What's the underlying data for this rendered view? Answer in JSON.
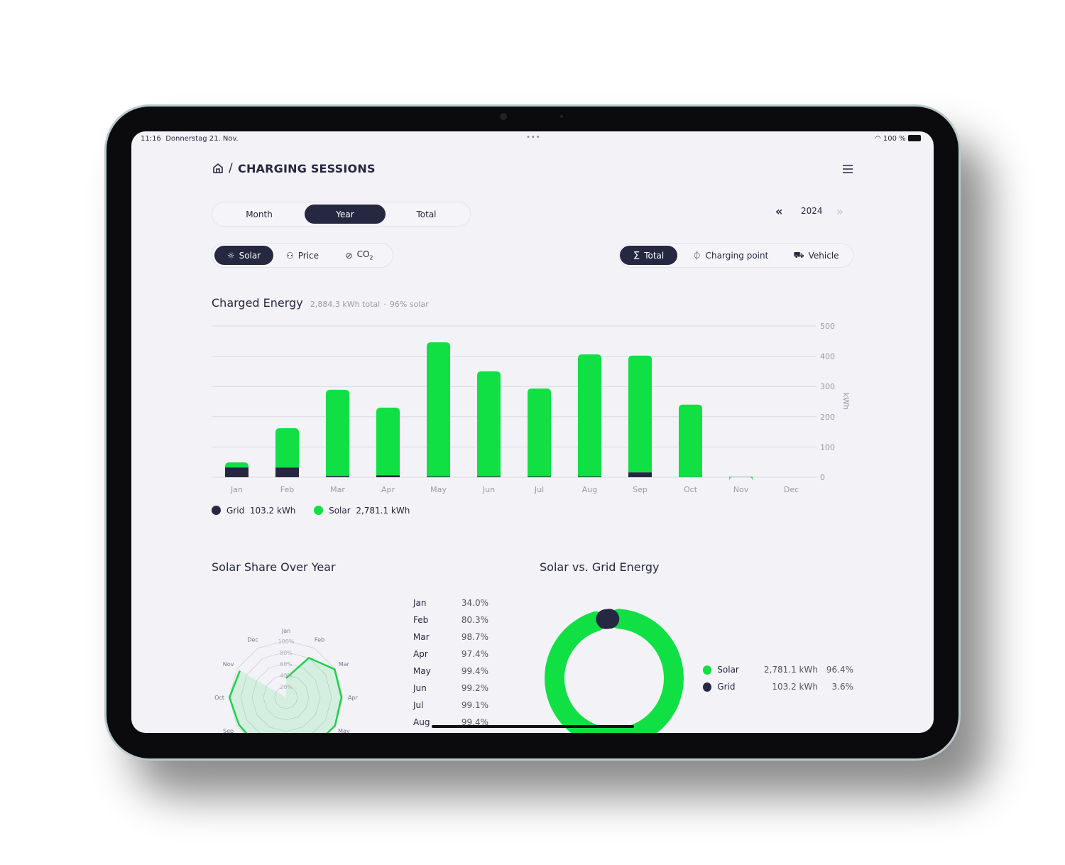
{
  "colors": {
    "solar": "#10e044",
    "grid": "#262740",
    "accent_dark": "#262740"
  },
  "status_bar": {
    "time": "11:16",
    "date": "Donnerstag 21. Nov.",
    "battery": "100 %"
  },
  "header": {
    "icon": "home-icon",
    "separator": "/",
    "title": "CHARGING SESSIONS",
    "menu_icon": "hamburger-icon"
  },
  "period_tabs": [
    {
      "label": "Month"
    },
    {
      "label": "Year",
      "selected": true
    },
    {
      "label": "Total"
    }
  ],
  "year_nav": {
    "prev": "«",
    "year": "2024",
    "next": "»"
  },
  "metric_filters": [
    {
      "label": "Solar",
      "icon": "sun-icon",
      "selected": true
    },
    {
      "label": "Price",
      "icon": "coins-icon"
    },
    {
      "label": "CO",
      "sub": "2",
      "icon": "leaf-icon"
    }
  ],
  "group_filters": [
    {
      "label": "Total",
      "icon": "sigma-icon",
      "selected": true
    },
    {
      "label": "Charging point",
      "icon": "plug-icon"
    },
    {
      "label": "Vehicle",
      "icon": "car-icon"
    }
  ],
  "charged_energy": {
    "title": "Charged Energy",
    "summary": "2,884.3 kWh total",
    "solar_share": "96% solar",
    "sep": "·"
  },
  "chart_data": [
    {
      "type": "bar",
      "stacked": true,
      "categories": [
        "Jan",
        "Feb",
        "Mar",
        "Apr",
        "May",
        "Jun",
        "Jul",
        "Aug",
        "Sep",
        "Oct",
        "Nov",
        "Dec"
      ],
      "series": [
        {
          "name": "Grid",
          "values": [
            32.3,
            32,
            3.8,
            6,
            2.7,
            2.8,
            2.6,
            2.4,
            16,
            0.5,
            0.5,
            0
          ]
        },
        {
          "name": "Solar",
          "values": [
            16.7,
            130,
            285.2,
            224,
            443.3,
            347.2,
            290.4,
            403.6,
            386,
            239.5,
            0.3,
            0
          ]
        }
      ],
      "ylabel": "kWh",
      "ylim": [
        0,
        500
      ],
      "yticks": [
        0,
        100,
        200,
        300,
        400,
        500
      ],
      "grid": true,
      "legend": [
        {
          "name": "Grid",
          "value": "103.2 kWh"
        },
        {
          "name": "Solar",
          "value": "2,781.1 kWh"
        }
      ]
    },
    {
      "type": "radar",
      "title": "Solar Share Over Year",
      "categories": [
        "Jan",
        "Feb",
        "Mar",
        "Apr",
        "May",
        "Jun",
        "Jul",
        "Aug",
        "Sep",
        "Oct",
        "Nov",
        "Dec"
      ],
      "values": [
        34.0,
        80.3,
        98.7,
        97.4,
        99.4,
        99.2,
        99.1,
        99.4,
        96,
        99.8,
        94,
        0
      ],
      "rings": [
        "20%",
        "40%",
        "60%",
        "80%",
        "100%"
      ],
      "table": [
        [
          "Jan",
          "34.0%"
        ],
        [
          "Feb",
          "80.3%"
        ],
        [
          "Mar",
          "98.7%"
        ],
        [
          "Apr",
          "97.4%"
        ],
        [
          "May",
          "99.4%"
        ],
        [
          "Jun",
          "99.2%"
        ],
        [
          "Jul",
          "99.1%"
        ],
        [
          "Aug",
          "99.4%"
        ]
      ]
    },
    {
      "type": "pie",
      "donut": true,
      "title": "Solar vs. Grid Energy",
      "slices": [
        {
          "name": "Solar",
          "value": 2781.1,
          "label": "2,781.1 kWh",
          "pct": "96.4%"
        },
        {
          "name": "Grid",
          "value": 103.2,
          "label": "103.2 kWh",
          "pct": "3.6%"
        }
      ]
    }
  ]
}
